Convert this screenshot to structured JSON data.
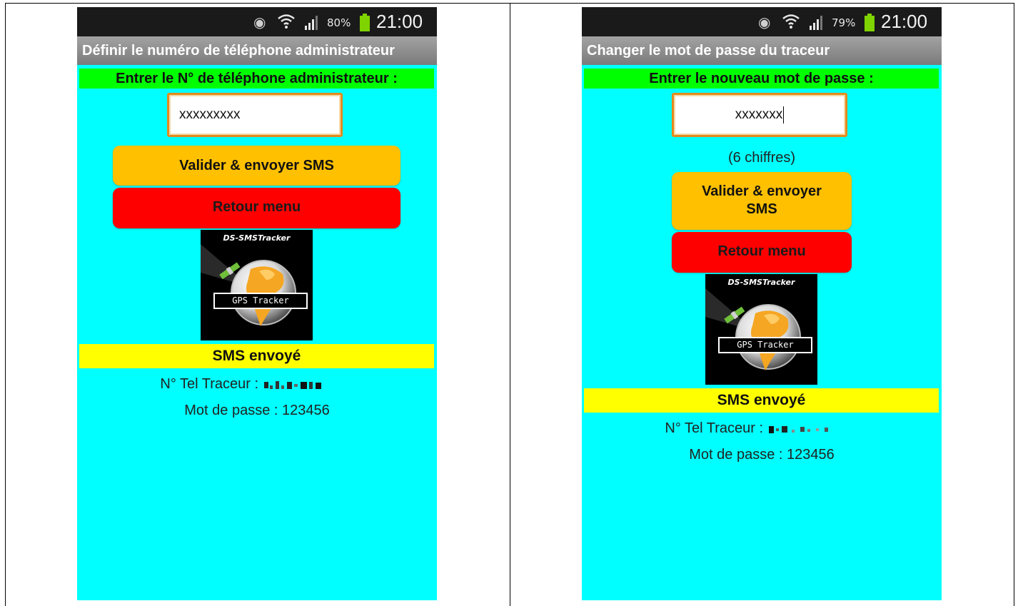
{
  "left": {
    "status": {
      "battery": "80%",
      "time": "21:00"
    },
    "title": "Définir le numéro de téléphone administrateur",
    "prompt": "Entrer le N° de téléphone administrateur :",
    "input_value": "xxxxxxxxx",
    "validate_button": "Valider & envoyer SMS",
    "back_button": "Retour menu",
    "logo": {
      "title": "DS-SMSTracker",
      "tag": "GPS Tracker"
    },
    "sms_status": "SMS envoyé",
    "tracker_label": "N° Tel Traceur :",
    "password_line": "Mot de passe : 123456"
  },
  "right": {
    "status": {
      "battery": "79%",
      "time": "21:00"
    },
    "title": "Changer le mot de passe du traceur",
    "prompt": "Entrer le nouveau mot de passe :",
    "input_value": "xxxxxxx",
    "hint": "(6 chiffres)",
    "validate_button_line1": "Valider & envoyer",
    "validate_button_line2": "SMS",
    "back_button": "Retour menu",
    "logo": {
      "title": "DS-SMSTracker",
      "tag": "GPS Tracker"
    },
    "sms_status": "SMS envoyé",
    "tracker_label": "N° Tel Traceur :",
    "password_line": "Mot de passe : 123456"
  },
  "colors": {
    "background": "#00ffff",
    "prompt_bar": "#00ff00",
    "validate_button": "#ffc000",
    "back_button": "#ff0000",
    "status_bar": "#ffff00",
    "input_border": "#e38a1f"
  }
}
